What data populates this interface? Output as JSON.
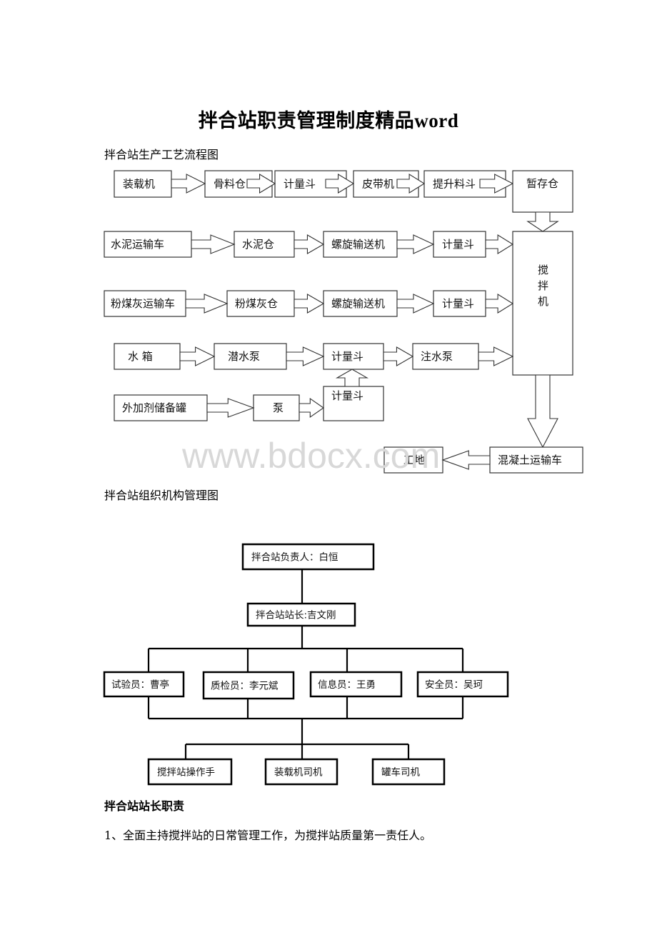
{
  "document": {
    "title": "拌合站职责管理制度精品word",
    "watermark": "www.bdocx.com"
  },
  "flowchart": {
    "caption": "拌合站生产工艺流程图",
    "rows": [
      [
        "装载机",
        "骨料仓",
        "计量斗",
        "皮带机",
        "提升料斗",
        "暂存仓"
      ],
      [
        "水泥运输车",
        "水泥仓",
        "螺旋输送机",
        "计量斗"
      ],
      [
        "粉煤灰运输车",
        "粉煤灰仓",
        "螺旋输送机",
        "计量斗"
      ],
      [
        "水  箱",
        "潜水泵",
        "计量斗",
        "注水泵"
      ],
      [
        "外加剂储备罐",
        "泵",
        "计量斗"
      ]
    ],
    "mixer": [
      "搅",
      "拌",
      "机"
    ],
    "output": [
      "混凝土运输车",
      "工地"
    ]
  },
  "org_chart": {
    "caption": "拌合站组织机构管理图",
    "head": "拌合站负责人：白恒",
    "manager": "拌合站站长:吉文刚",
    "staff": [
      "试验员：曹亭",
      "质检员：李元斌",
      "信息员：王勇",
      "安全员：吴珂"
    ],
    "workers": [
      "搅拌站操作手",
      "装载机司机",
      "罐车司机"
    ]
  },
  "section": {
    "heading": "拌合站站长职责",
    "items": [
      "1、全面主持搅拌站的日常管理工作，为搅拌站质量第一责任人。"
    ]
  }
}
